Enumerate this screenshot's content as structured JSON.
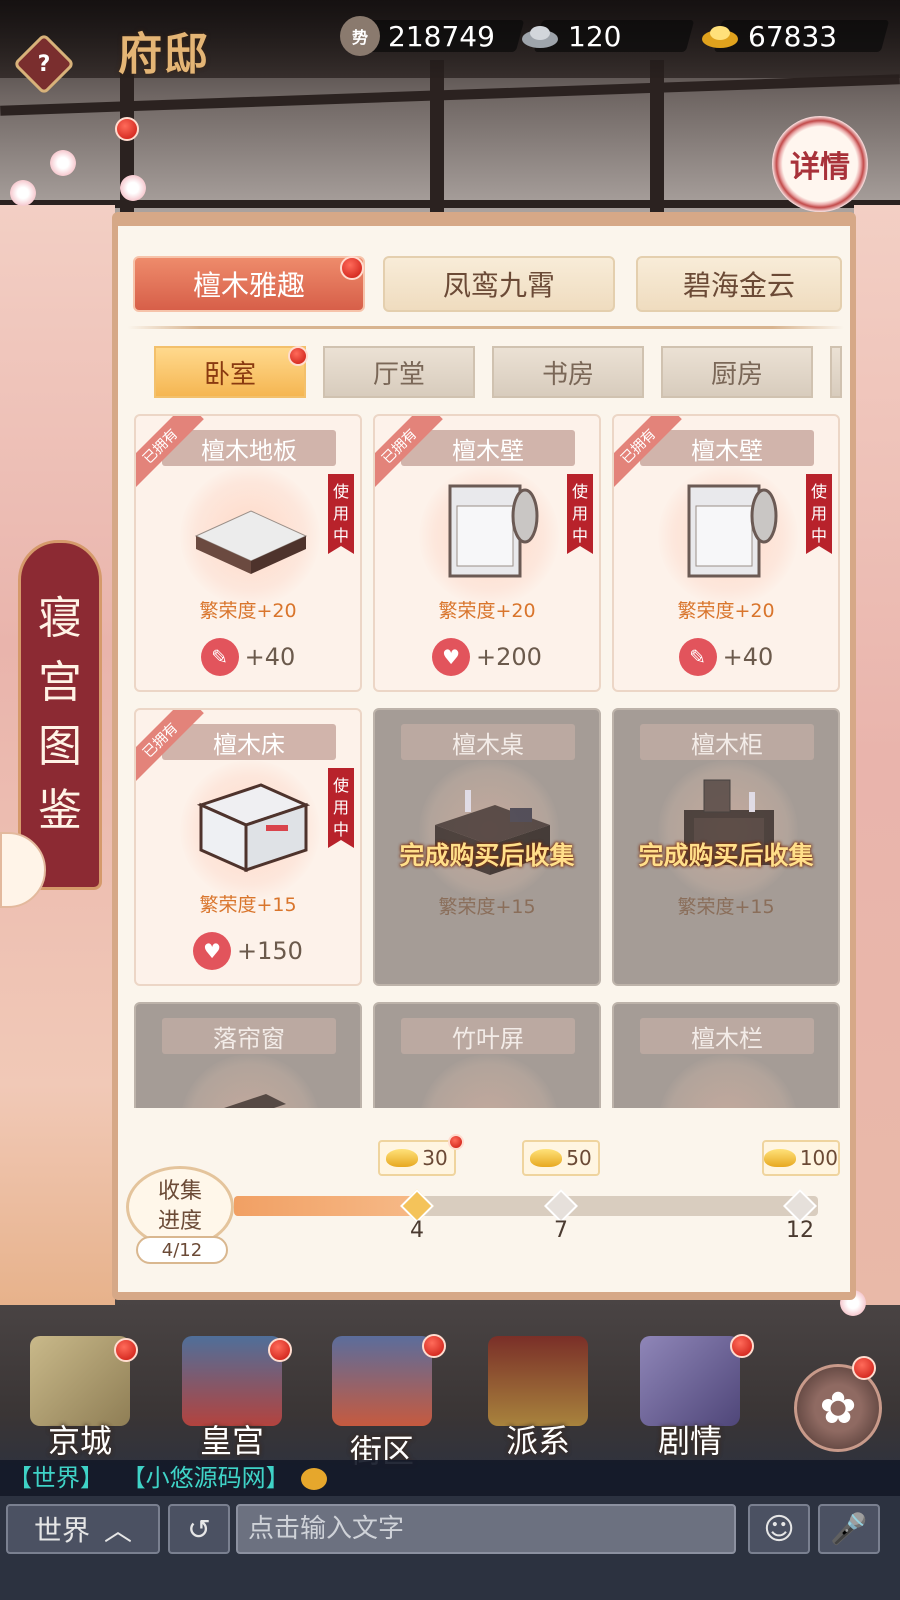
{
  "header": {
    "title": "府邸",
    "resources": [
      {
        "icon": "prestige-coin-icon",
        "badge": "势",
        "value": "218749"
      },
      {
        "icon": "silver-ingot-icon",
        "value": "120"
      },
      {
        "icon": "gold-ingot-icon",
        "value": "67833"
      }
    ],
    "help_label": "?",
    "detail_label": "详情"
  },
  "side_banner": {
    "chars": [
      "寝",
      "宫",
      "图",
      "鉴"
    ]
  },
  "categories": [
    {
      "label": "檀木雅趣",
      "active": true
    },
    {
      "label": "凤鸾九霄",
      "active": false
    },
    {
      "label": "碧海金云",
      "active": false
    }
  ],
  "rooms": [
    {
      "label": "卧室",
      "active": true
    },
    {
      "label": "厅堂",
      "active": false
    },
    {
      "label": "书房",
      "active": false
    },
    {
      "label": "厨房",
      "active": false
    }
  ],
  "labels": {
    "owned": "已拥有",
    "in_use": "使用中",
    "locked_hint": "完成购买后收集"
  },
  "items": [
    {
      "name": "檀木地板",
      "prosperity": "繁荣度+20",
      "bonus_icon": "brush-icon",
      "bonus": "+40",
      "owned": true,
      "in_use": true
    },
    {
      "name": "檀木壁",
      "prosperity": "繁荣度+20",
      "bonus_icon": "heart-icon",
      "bonus": "+200",
      "owned": true,
      "in_use": true
    },
    {
      "name": "檀木壁",
      "prosperity": "繁荣度+20",
      "bonus_icon": "brush-icon",
      "bonus": "+40",
      "owned": true,
      "in_use": true
    },
    {
      "name": "檀木床",
      "prosperity": "繁荣度+15",
      "bonus_icon": "heart-icon",
      "bonus": "+150",
      "owned": true,
      "in_use": true
    },
    {
      "name": "檀木桌",
      "prosperity": "繁荣度+15",
      "owned": false
    },
    {
      "name": "檀木柜",
      "prosperity": "繁荣度+15",
      "owned": false
    },
    {
      "name": "落帘窗",
      "owned": false
    },
    {
      "name": "竹叶屏",
      "owned": false
    },
    {
      "name": "檀木栏",
      "owned": false
    }
  ],
  "progress": {
    "label_line1": "收集",
    "label_line2": "进度",
    "count": "4/12",
    "current": 4,
    "total": 12,
    "milestones": [
      {
        "threshold": "4",
        "reward": "30",
        "reached": true
      },
      {
        "threshold": "7",
        "reward": "50",
        "reached": false
      },
      {
        "threshold": "12",
        "reward": "100",
        "reached": false
      }
    ]
  },
  "bottom_nav": [
    {
      "label": "京城",
      "icon": "map-icon"
    },
    {
      "label": "皇宫",
      "icon": "palace-icon"
    },
    {
      "label": "街区",
      "icon": "market-icon"
    },
    {
      "label": "派系",
      "icon": "faction-banner-icon"
    },
    {
      "label": "剧情",
      "icon": "book-icon"
    }
  ],
  "chat": {
    "line_channel": "【世界】",
    "line_text": "【小悠源码网】",
    "channel_button": "世界",
    "input_placeholder": "点击输入文字"
  },
  "colors": {
    "accent_red": "#d75f49",
    "gold": "#f5b652",
    "panel_bg": "#fbf5ec",
    "progress_fill": "#f1a064"
  }
}
